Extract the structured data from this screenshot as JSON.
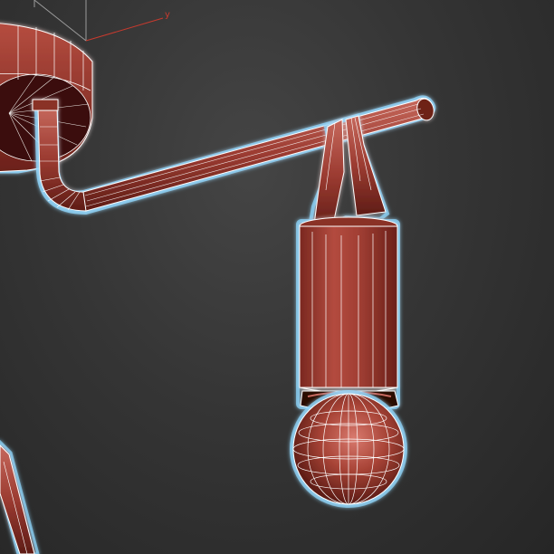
{
  "viewport": {
    "axis_y_label": "y"
  },
  "colors": {
    "background": "#333333",
    "mesh_fill": "#9b3b31",
    "mesh_dark": "#5a1a14",
    "mesh_highlight": "#c66a5e",
    "wireframe": "#ffffff",
    "selection_glow": "#8fd8ff",
    "axis_x": "#c83a2e",
    "axis_y": "#c83a2e",
    "grid_line": "#9a9a9a"
  },
  "objects": [
    {
      "name": "ceiling-canopy"
    },
    {
      "name": "curved-arm-rod"
    },
    {
      "name": "hanging-strap"
    },
    {
      "name": "lamp-cylinder-shade"
    },
    {
      "name": "bulb-sphere"
    }
  ]
}
